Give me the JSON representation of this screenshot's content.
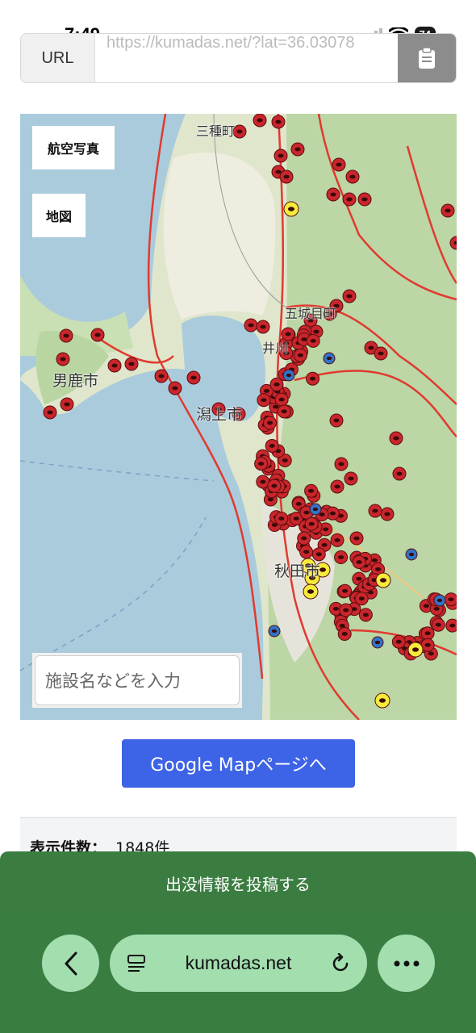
{
  "status": {
    "time": "7:49",
    "battery": "74"
  },
  "url_bar": {
    "label": "URL",
    "value": "https://kumadas.net/?lat=36.03078"
  },
  "map": {
    "aerial_button": "航空写真",
    "map_button": "地図",
    "search_placeholder": "施設名などを入力",
    "places": {
      "sanshu": "三種町",
      "gojome": "五城目町",
      "oga": "男鹿市",
      "katagami": "潟上市",
      "ikawa": "井川",
      "akita": "秋田市"
    }
  },
  "google_map_button": "Google Mapページへ",
  "results": {
    "label": "表示件数：",
    "value": "1848件"
  },
  "post_button": "出没情報を投稿する",
  "browser": {
    "address": "kumadas.net"
  },
  "colors": {
    "marker_red": "#c9262c",
    "marker_yellow": "#f5ec3a",
    "marker_blue": "#2f74c8",
    "toolbar_green": "#3a7d41",
    "button_blue": "#3d63e6"
  }
}
